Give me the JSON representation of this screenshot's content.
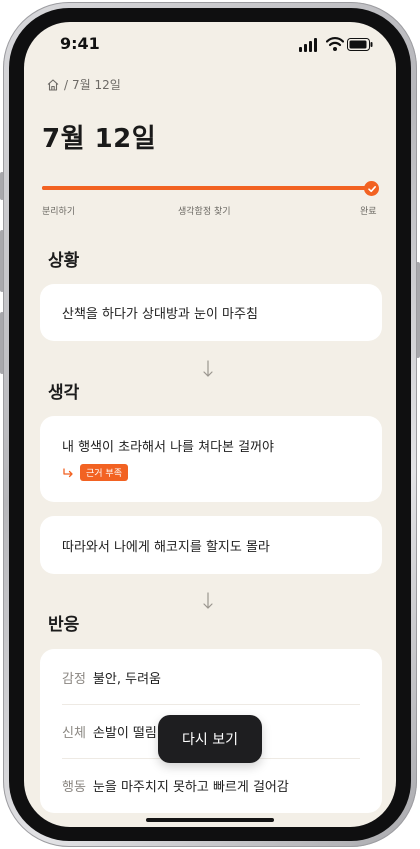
{
  "status_bar": {
    "time": "9:41"
  },
  "breadcrumb": {
    "separator": "/",
    "current": "7월 12일"
  },
  "page": {
    "title": "7월 12일"
  },
  "progress": {
    "value": 1.0,
    "steps": [
      "분리하기",
      "생각함정 찾기",
      "완료"
    ],
    "color": "#f26222"
  },
  "sections": {
    "situation": {
      "heading": "상황",
      "text": "산책을 하다가 상대방과 눈이 마주침"
    },
    "thought": {
      "heading": "생각",
      "items": [
        {
          "text": "내 행색이 초라해서 나를 쳐다본 걸꺼야",
          "tag": "근거 부족"
        },
        {
          "text": "따라와서 나에게 해코지를 할지도 몰라"
        }
      ]
    },
    "reaction": {
      "heading": "반응",
      "rows": [
        {
          "label": "감정",
          "value": "불안, 두려움"
        },
        {
          "label": "신체",
          "value": "손발이 떨림"
        },
        {
          "label": "행동",
          "value": "눈을 마주치지 못하고 빠르게 걸어감"
        }
      ]
    }
  },
  "toast": {
    "label": "다시 보기"
  },
  "colors": {
    "accent": "#f26222",
    "background": "#f3efe7",
    "card": "#ffffff"
  },
  "icons": [
    "home-icon",
    "check-icon",
    "down-arrow-icon",
    "signal-icon",
    "wifi-icon",
    "battery-icon"
  ]
}
